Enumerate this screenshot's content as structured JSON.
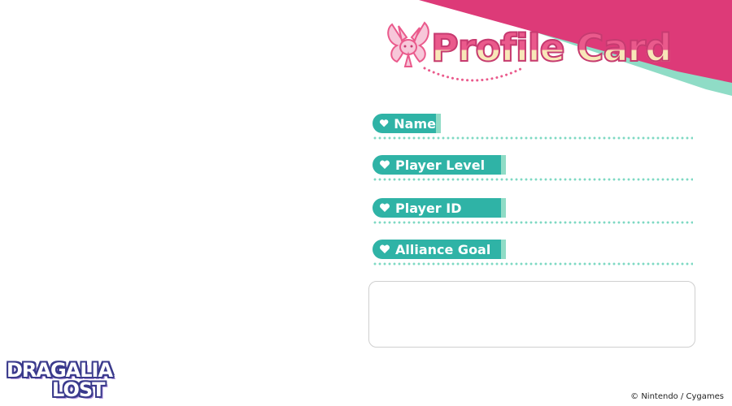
{
  "colors": {
    "banner_pink": "#dd3a78",
    "banner_mint": "#8fdcc6",
    "pill_teal": "#2fb3a6",
    "dot_mint": "#7ed9c3",
    "title_pink": "#ea5a8c"
  },
  "header": {
    "title": "Profile Card",
    "mascot_icon": "winged-creature-icon"
  },
  "fields": [
    {
      "label": "Name",
      "icon": "heart-icon"
    },
    {
      "label": "Player Level",
      "icon": "heart-icon"
    },
    {
      "label": "Player ID",
      "icon": "heart-icon"
    },
    {
      "label": "Alliance Goal",
      "icon": "heart-icon"
    }
  ],
  "comment": {
    "value": ""
  },
  "logo": {
    "line1": "DRAGALIA",
    "line2": "LOST"
  },
  "footer": {
    "copyright": "© Nintendo / Cygames"
  }
}
